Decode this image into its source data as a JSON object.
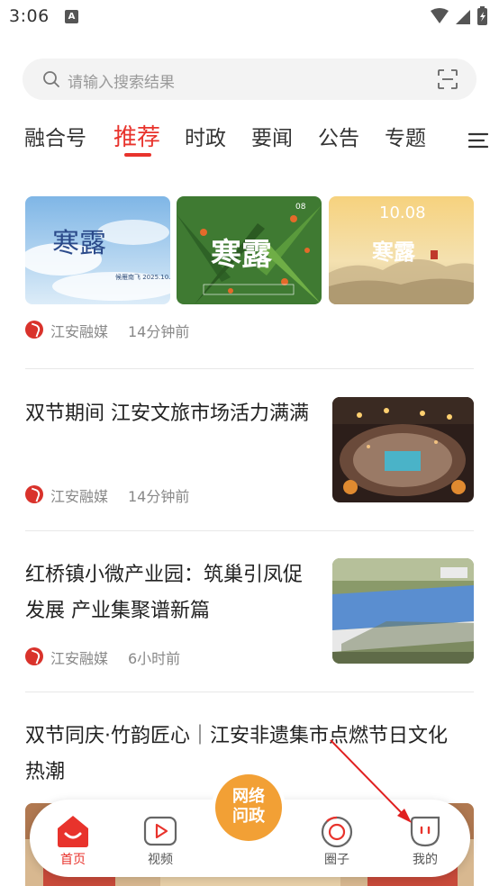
{
  "status_bar": {
    "time": "3:06",
    "notification_icon": "A"
  },
  "search": {
    "placeholder": "请输入搜索结果"
  },
  "tabs": [
    {
      "label": "融合号"
    },
    {
      "label": "推荐",
      "active": true
    },
    {
      "label": "时政"
    },
    {
      "label": "要闻"
    },
    {
      "label": "公告"
    },
    {
      "label": "专题"
    }
  ],
  "feed": {
    "item1": {
      "source": "江安融媒",
      "time": "14分钟前",
      "image1_text": "寒露",
      "image1_caption": "候雁南飞 2025.10.08",
      "image2_text": "寒露",
      "image2_date": "08",
      "image3_date": "10.08",
      "image3_text": "寒露"
    },
    "item2": {
      "title": "双节期间 江安文旅市场活力满满",
      "source": "江安融媒",
      "time": "14分钟前"
    },
    "item3": {
      "title": "红桥镇小微产业园：筑巢引凤促发展 产业集聚谱新篇",
      "source": "江安融媒",
      "time": "6小时前"
    },
    "item4": {
      "title": "双节同庆·竹韵匠心｜江安非遗集市点燃节日文化热潮"
    }
  },
  "bottom_nav": {
    "home": "首页",
    "video": "视频",
    "center_line1": "网络",
    "center_line2": "问政",
    "circle": "圈子",
    "mine": "我的"
  },
  "colors": {
    "accent": "#e8332c",
    "center_button": "#f2a035",
    "annotation_arrow": "#e02020"
  }
}
